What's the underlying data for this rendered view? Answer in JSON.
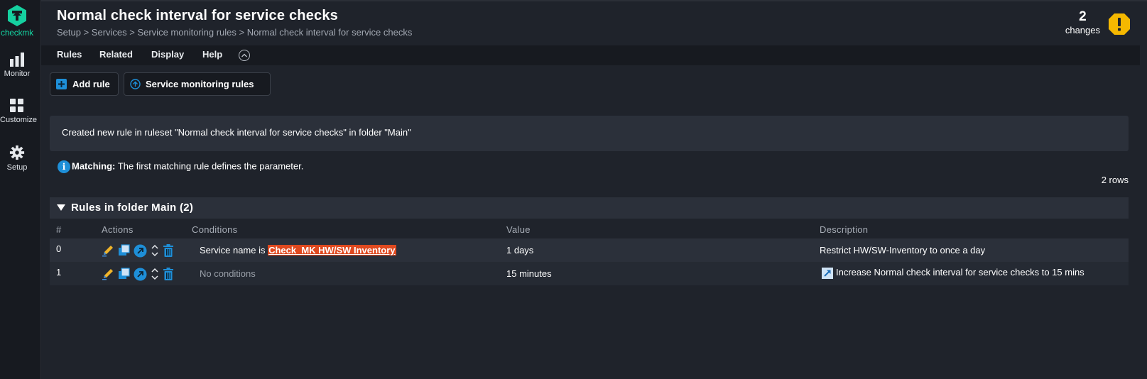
{
  "app": {
    "logo_text": "checkmk",
    "brand_color": "#15d1a0",
    "accent_color": "#1e8fd8",
    "warning_color": "#f5b800"
  },
  "sidebar": {
    "items": [
      {
        "label": "Monitor",
        "icon": "bar-chart-icon"
      },
      {
        "label": "Customize",
        "icon": "grid-icon"
      },
      {
        "label": "Setup",
        "icon": "gear-icon"
      }
    ]
  },
  "header": {
    "title": "Normal check interval for service checks",
    "breadcrumb": "Setup > Services > Service monitoring rules > Normal check interval for service checks",
    "changes_count": "2",
    "changes_label": "changes"
  },
  "menu": {
    "items": [
      "Rules",
      "Related",
      "Display",
      "Help"
    ]
  },
  "toolbar": {
    "add_rule": "Add rule",
    "service_monitoring_rules": "Service monitoring rules"
  },
  "message": "Created new rule in ruleset \"Normal check interval for service checks\" in folder \"Main\"",
  "matching": {
    "label": "Matching:",
    "text": "The first matching rule defines the parameter."
  },
  "rows_count": "2 rows",
  "folder": {
    "title": "Rules in folder Main (2)",
    "columns": [
      "#",
      "Actions",
      "Conditions",
      "Value",
      "Description"
    ],
    "rows": [
      {
        "num": "0",
        "condition_prefix": "Service name is ",
        "condition_highlight": "Check_MK HW/SW Inventory",
        "value": "1 days",
        "description": "Restrict HW/SW-Inventory to once a day"
      },
      {
        "num": "1",
        "condition_text": "No conditions",
        "value": "15 minutes",
        "description": "Increase Normal check interval for service checks to 15 mins"
      }
    ]
  }
}
